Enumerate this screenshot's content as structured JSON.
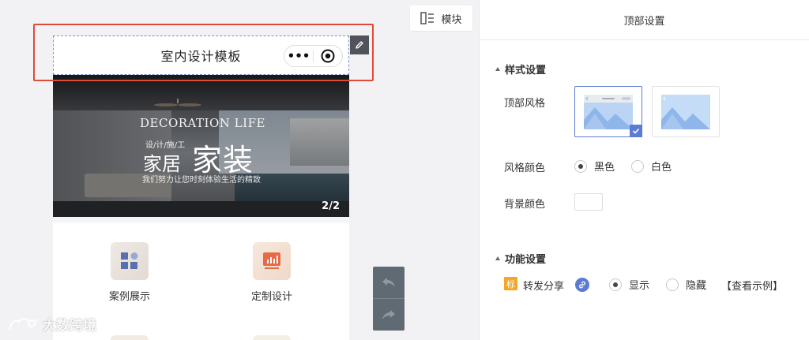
{
  "canvas": {
    "module_button_label": "模块",
    "page_title": "室内设计模板",
    "capsule_more": "•••",
    "banner": {
      "headline_en": "DECORATION LIFE",
      "subline": "设/计/施/工",
      "word_home": "家居",
      "word_decoration": "家装",
      "slogan": "我们努力让您时刻体验生活的精致",
      "counter": "2/2"
    },
    "grid_items": [
      {
        "label": "案例展示",
        "icon": "grid-apps-icon"
      },
      {
        "label": "定制设计",
        "icon": "bar-chart-icon"
      }
    ],
    "watermark": "大数跨境"
  },
  "panel": {
    "title": "顶部设置",
    "style_section": {
      "title": "样式设置",
      "top_style_label": "顶部风格",
      "style_options": [
        {
          "name": "style-light-bar",
          "selected": true
        },
        {
          "name": "style-transparent",
          "selected": false
        }
      ],
      "style_color_label": "风格颜色",
      "color_options": [
        {
          "label": "黑色",
          "checked": true
        },
        {
          "label": "白色",
          "checked": false
        }
      ],
      "bg_color_label": "背景颜色",
      "bg_color_value": "#ffffff"
    },
    "function_section": {
      "title": "功能设置",
      "tag": "标",
      "share_label": "转发分享",
      "share_options": [
        {
          "label": "显示",
          "checked": true
        },
        {
          "label": "隐藏",
          "checked": false
        }
      ],
      "view_example": "【查看示例】"
    }
  },
  "colors": {
    "accent": "#5b7bd5",
    "highlight_border": "#e14a3b",
    "tag_orange": "#f5a623",
    "toolbar_dark": "#5f6a72"
  }
}
